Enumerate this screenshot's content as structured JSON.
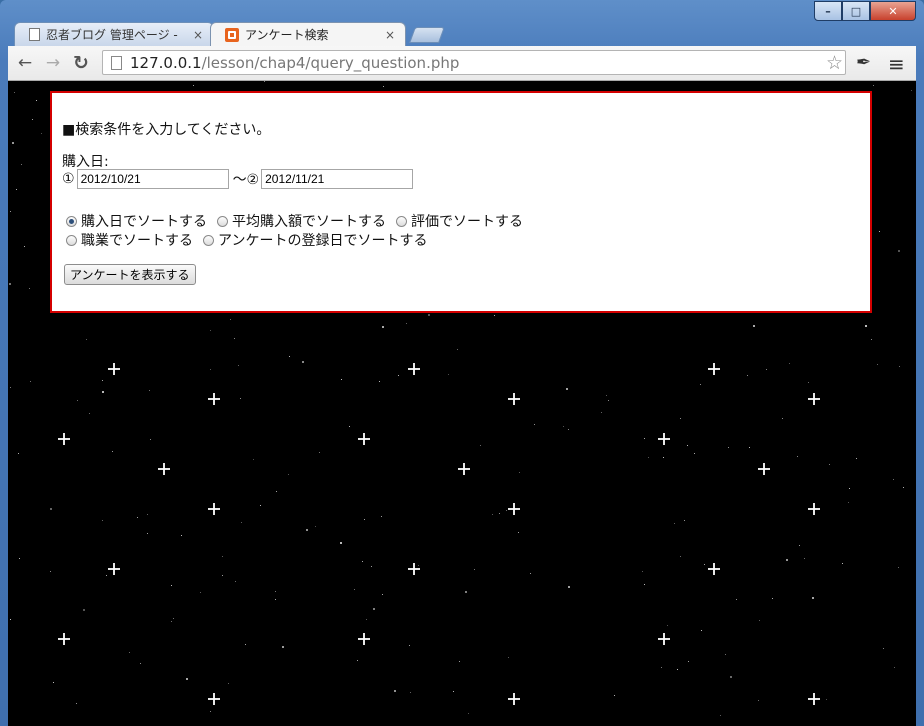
{
  "browser": {
    "tabs": [
      {
        "label": "忍者ブログ 管理ページ -",
        "close": "×"
      },
      {
        "label": "アンケート検索",
        "close": "×"
      }
    ],
    "url_host": "127.0.0.1",
    "url_path": "/lesson/chap4/query_question.php"
  },
  "window_controls": {
    "minimize": "–",
    "maximize": "□",
    "close": "✕"
  },
  "toolbar": {
    "back": "←",
    "forward": "→",
    "reload": "↻",
    "star": "☆",
    "eyedropper": "✒",
    "menu": "≡"
  },
  "form": {
    "heading": "■検索条件を入力してください。",
    "date_label": "購入日:",
    "date_from_marker": "①",
    "date_from_value": "2012/10/21",
    "date_sep": "〜②",
    "date_to_value": "2012/11/21",
    "sort_options_row1": [
      {
        "label": "購入日でソートする",
        "checked": true
      },
      {
        "label": "平均購入額でソートする",
        "checked": false
      },
      {
        "label": "評価でソートする",
        "checked": false
      }
    ],
    "sort_options_row2": [
      {
        "label": "職業でソートする",
        "checked": false
      },
      {
        "label": "アンケートの登録日でソートする",
        "checked": false
      }
    ],
    "submit_label": "アンケートを表示する"
  }
}
